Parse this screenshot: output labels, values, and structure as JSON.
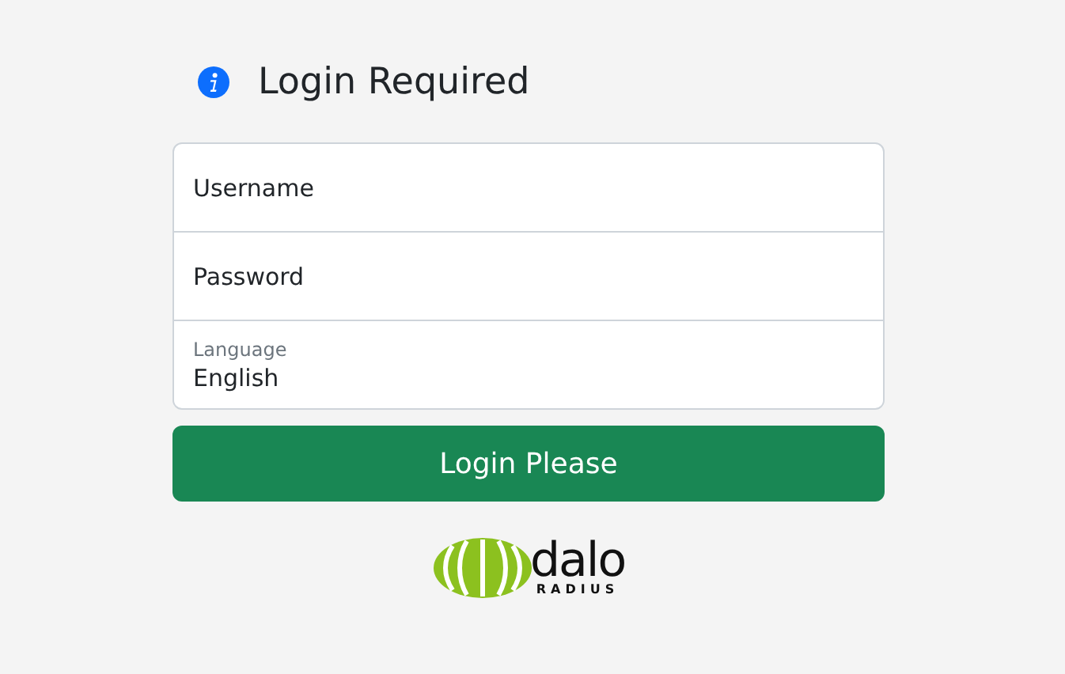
{
  "heading": "Login Required",
  "fields": [
    {
      "kind": "input",
      "placeholder": "Username"
    },
    {
      "kind": "input",
      "placeholder": "Password"
    },
    {
      "kind": "select",
      "label": "Language",
      "value": "English"
    }
  ],
  "submit": "Login Please",
  "logo": {
    "word": "dalo",
    "subword": "RADIUS"
  }
}
